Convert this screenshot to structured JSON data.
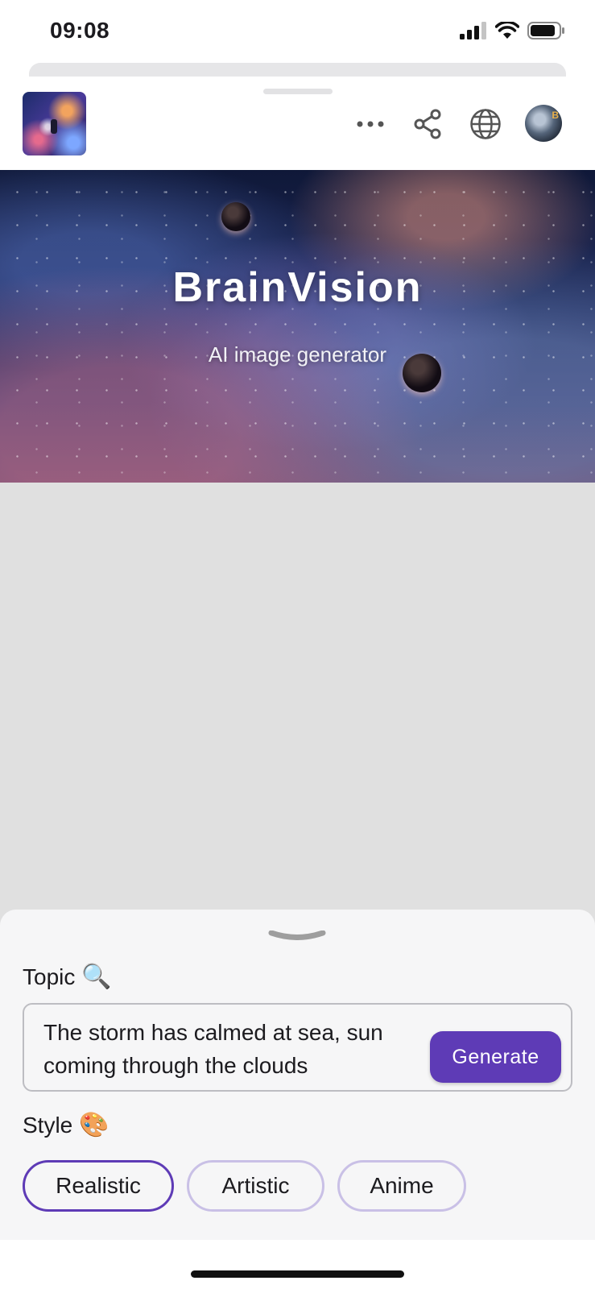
{
  "status_bar": {
    "time": "09:08",
    "icons": [
      "cellular-signal-icon",
      "wifi-icon",
      "battery-icon"
    ]
  },
  "header": {
    "thumbnail": "app-thumbnail-nebula",
    "icons": [
      "more-dots-icon",
      "share-icon",
      "globe-icon",
      "user-avatar"
    ]
  },
  "hero": {
    "title": "BrainVision",
    "subtitle": "AI image generator"
  },
  "panel": {
    "topic_label": "Topic",
    "topic_emoji": "🔍",
    "topic_value": "The storm has calmed at sea, sun coming through the clouds",
    "generate_label": "Generate",
    "style_label": "Style",
    "style_emoji": "🎨",
    "styles": [
      {
        "label": "Realistic",
        "selected": true
      },
      {
        "label": "Artistic",
        "selected": false
      },
      {
        "label": "Anime",
        "selected": false
      }
    ]
  },
  "colors": {
    "accent": "#5e3bb6",
    "chip_border": "#c9c0e6",
    "content_bg": "#e0e0e0",
    "panel_bg": "#f6f6f7"
  }
}
